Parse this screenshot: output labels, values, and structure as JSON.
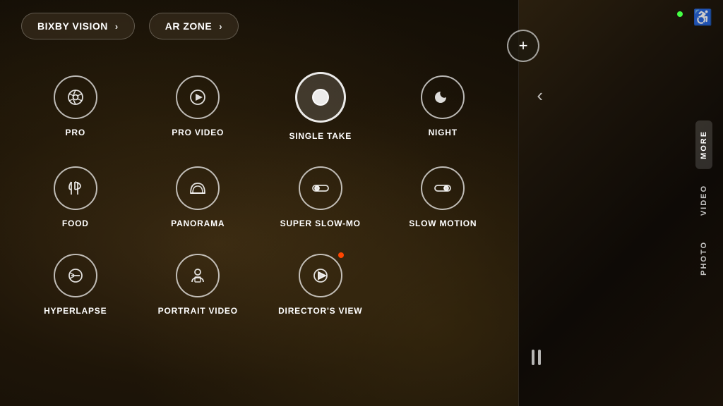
{
  "background": {
    "color": "#1a1008"
  },
  "top_buttons": [
    {
      "label": "BIXBY VISION",
      "chevron": "›"
    },
    {
      "label": "AR ZONE",
      "chevron": "›"
    }
  ],
  "modes": [
    {
      "id": "pro",
      "label": "PRO",
      "icon_type": "aperture",
      "highlighted": false
    },
    {
      "id": "pro-video",
      "label": "PRO VIDEO",
      "icon_type": "play-circle",
      "highlighted": false
    },
    {
      "id": "single-take",
      "label": "SINGLE TAKE",
      "icon_type": "single-take",
      "highlighted": true
    },
    {
      "id": "night",
      "label": "NIGHT",
      "icon_type": "moon",
      "highlighted": false
    },
    {
      "id": "food",
      "label": "FOOD",
      "icon_type": "food",
      "highlighted": false
    },
    {
      "id": "panorama",
      "label": "PANORAMA",
      "icon_type": "panorama",
      "highlighted": false
    },
    {
      "id": "super-slow-mo",
      "label": "SUPER SLOW-MO",
      "icon_type": "toggle-left",
      "highlighted": false
    },
    {
      "id": "slow-motion",
      "label": "SLOW MOTION",
      "icon_type": "toggle-right",
      "highlighted": false
    },
    {
      "id": "hyperlapse",
      "label": "HYPERLAPSE",
      "icon_type": "hyperlapse",
      "highlighted": false
    },
    {
      "id": "portrait-video",
      "label": "PORTRAIT VIDEO",
      "icon_type": "portrait-video",
      "highlighted": false
    },
    {
      "id": "directors-view",
      "label": "DIRECTOR'S VIEW",
      "icon_type": "directors-view",
      "highlighted": false,
      "has_dot": true
    }
  ],
  "vertical_tabs": [
    {
      "label": "MORE",
      "active": true
    },
    {
      "label": "VIDEO",
      "active": false
    },
    {
      "label": "PHOTO",
      "active": false
    }
  ],
  "plus_button_label": "+",
  "green_dot_visible": true,
  "colors": {
    "accent_orange": "#ff4500",
    "accent_green": "#44ff44",
    "text_white": "#ffffff",
    "border_white": "rgba(255,255,255,0.7)"
  }
}
